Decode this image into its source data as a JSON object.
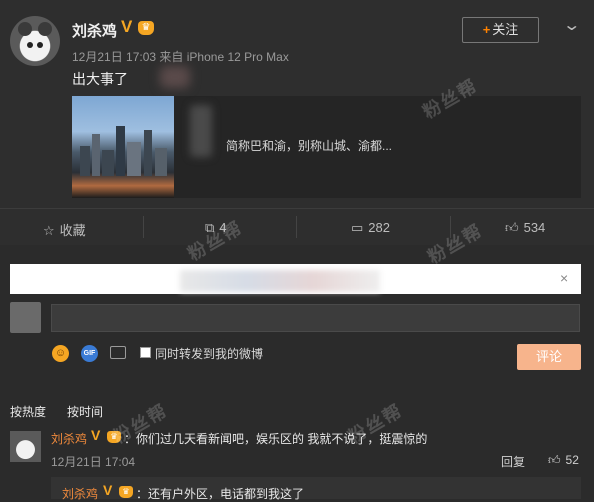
{
  "post": {
    "username": "刘杀鸡",
    "vip_badge": "V",
    "time": "12月21日 17:03",
    "source_prefix": "来自",
    "device": "iPhone 12 Pro Max",
    "follow_label": "关注",
    "follow_icon": "plus-icon",
    "text": "出大事了",
    "card_text": "简称巴和渝，别称山城、渝都..."
  },
  "actions": {
    "favorite_label": "收藏",
    "repost_count": "4",
    "comment_count": "282",
    "like_count": "534"
  },
  "composer": {
    "close_icon": "×",
    "repost_checkbox_label": "同时转发到我的微博",
    "submit_label": "评论"
  },
  "sort": {
    "hot": "按热度",
    "time": "按时间"
  },
  "comments": [
    {
      "username": "刘杀鸡",
      "vip_badge": "V",
      "text": "：你们过几天看新闻吧，娱乐区的 我就不说了，挺震惊的",
      "time": "12月21日 17:04",
      "reply_label": "回复",
      "like_count": "52",
      "reply": {
        "username": "刘杀鸡",
        "vip_badge": "V",
        "text": "：还有户外区，电话都到我这了"
      }
    }
  ],
  "watermark": "粉丝帮",
  "colors": {
    "background": "#2b2b2b",
    "accent": "#ff8200",
    "vip": "#f5a623",
    "submit": "#f7b48c"
  }
}
